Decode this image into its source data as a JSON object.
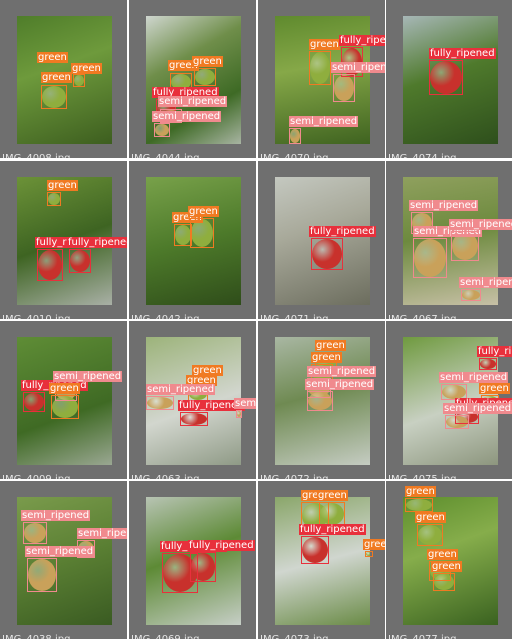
{
  "colors": {
    "green": "#f07a22",
    "fully_ripened": "#e8303c",
    "semi_ripened": "#f08a8e",
    "tile_bg": "#6f6f6f"
  },
  "label_names": {
    "green": "green",
    "fully_ripened": "fully_ripened",
    "semi_ripened": "semi_ripened"
  },
  "grid": [
    {
      "filename": "IMG_4008.jpg",
      "detections": [
        "green",
        "green",
        "green"
      ]
    },
    {
      "filename": "IMG_4044.jpg",
      "detections": [
        "green",
        "green",
        "fully_ripened",
        "semi_ripened",
        "semi_ripened"
      ]
    },
    {
      "filename": "IMG_4070.jpg",
      "detections": [
        "green",
        "fully_ripened",
        "semi_ripened",
        "semi_ripened"
      ]
    },
    {
      "filename": "IMG_4074.jpg",
      "detections": [
        "fully_ripened"
      ]
    },
    {
      "filename": "IMG_4010.jpg",
      "detections": [
        "green",
        "fully_ripened",
        "fully_ripened"
      ]
    },
    {
      "filename": "IMG_4042.jpg",
      "detections": [
        "green",
        "green"
      ]
    },
    {
      "filename": "IMG_4071.jpg",
      "detections": [
        "fully_ripened"
      ]
    },
    {
      "filename": "IMG_4067.jpg",
      "detections": [
        "semi_ripened",
        "semi_ripened",
        "semi_ripened",
        "semi_ripened"
      ]
    },
    {
      "filename": "IMG_4009.jpg",
      "detections": [
        "fully_ripened",
        "semi_ripened",
        "green"
      ]
    },
    {
      "filename": "IMG_4063.jpg",
      "detections": [
        "green",
        "green",
        "semi_ripened",
        "fully_ripened",
        "semi_ripened"
      ]
    },
    {
      "filename": "IMG_4072.jpg",
      "detections": [
        "green",
        "green",
        "semi_ripened",
        "semi_ripened"
      ]
    },
    {
      "filename": "IMG_4075.jpg",
      "detections": [
        "fully_ripened",
        "semi_ripened",
        "green",
        "fully_ripened",
        "semi_ripened"
      ]
    },
    {
      "filename": "IMG_4038.jpg",
      "detections": [
        "semi_ripened",
        "semi_ripened",
        "semi_ripened"
      ]
    },
    {
      "filename": "IMG_4069.jpg",
      "detections": [
        "fully_ripened",
        "fully_ripened"
      ]
    },
    {
      "filename": "IMG_4073.jpg",
      "detections": [
        "green",
        "green",
        "fully_ripened",
        "green"
      ]
    },
    {
      "filename": "IMG_4077.jpg",
      "detections": [
        "green",
        "green",
        "green",
        "green"
      ]
    }
  ]
}
